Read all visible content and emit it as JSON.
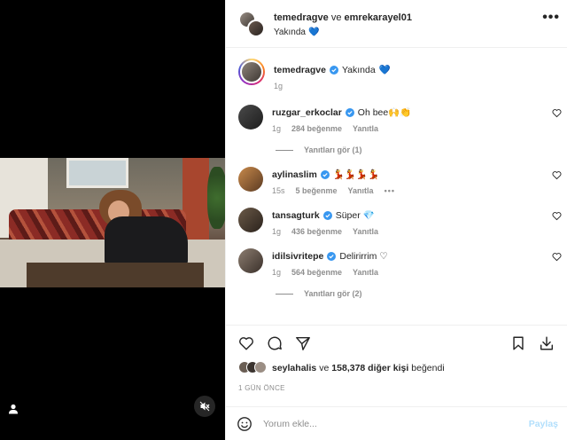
{
  "header": {
    "author": "temedragve",
    "connector": "ve",
    "coauthor": "emrekarayel01",
    "subtitle": "Yakında",
    "subtitle_emoji": "💙"
  },
  "caption": {
    "username": "temedragve",
    "text": "Yakında",
    "emoji": "💙",
    "time": "1g"
  },
  "comments": [
    {
      "username": "ruzgar_erkoclar",
      "text": "Oh bee🙌👏",
      "time": "1g",
      "likes": "284 beğenme",
      "reply": "Yanıtla"
    },
    {
      "username": "aylinaslim",
      "text": "💃💃💃💃",
      "time": "15s",
      "likes": "5 beğenme",
      "reply": "Yanıtla",
      "more": "•••"
    },
    {
      "username": "tansagturk",
      "text": "Süper 💎",
      "time": "1g",
      "likes": "436 beğenme",
      "reply": "Yanıtla"
    },
    {
      "username": "idilsivritepe",
      "text": "Delirirrim ♡󠅟",
      "time": "1g",
      "likes": "564 beğenme",
      "reply": "Yanıtla"
    }
  ],
  "view_replies": [
    "Yanıtları gör (1)",
    "Yanıtları gör (2)"
  ],
  "likes_summary": {
    "user": "seylahalis",
    "connector": "ve",
    "others": "158,378 diğer kişi",
    "suffix": "beğendi"
  },
  "timestamp": "1 GÜN ÖNCE",
  "composer": {
    "placeholder": "Yorum ekle...",
    "post_label": "Paylaş"
  },
  "colors": {
    "verified": "#3897f0",
    "link_disabled": "#b2dffc",
    "muted": "#8e8e8e"
  }
}
